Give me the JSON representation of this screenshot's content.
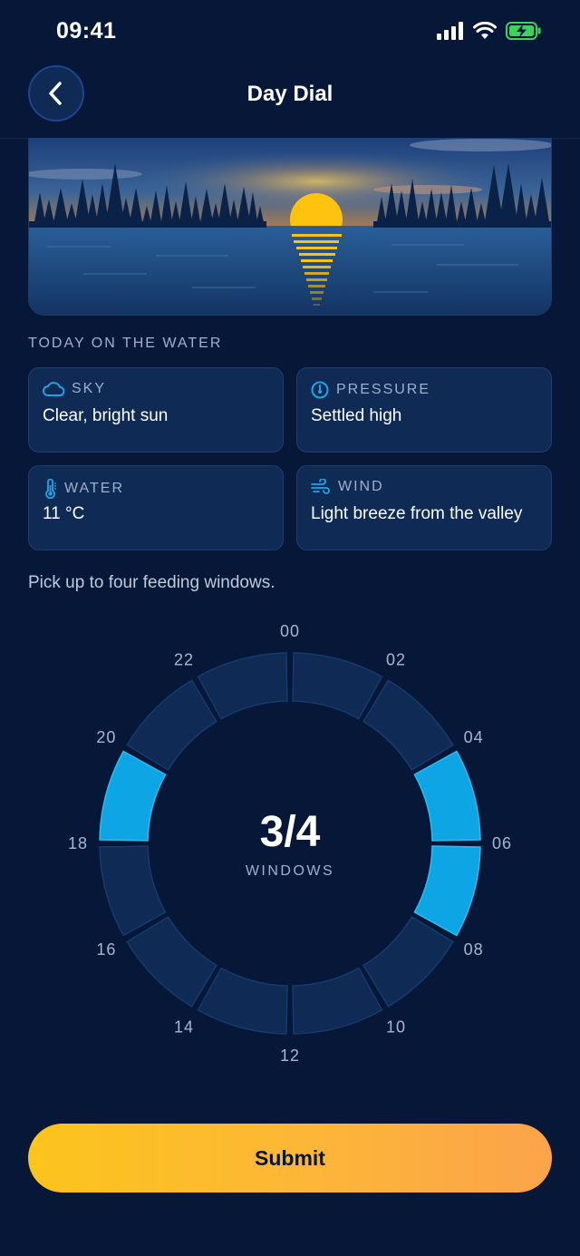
{
  "status": {
    "time": "09:41"
  },
  "nav": {
    "title": "Day Dial"
  },
  "section": {
    "label": "TODAY ON THE WATER"
  },
  "conditions": [
    {
      "label": "SKY",
      "value": "Clear, bright sun",
      "icon": "cloud-icon"
    },
    {
      "label": "PRESSURE",
      "value": "Settled high",
      "icon": "gauge-icon"
    },
    {
      "label": "WATER",
      "value": "11 °C",
      "icon": "thermometer-icon"
    },
    {
      "label": "WIND",
      "value": "Light breeze from the valley",
      "icon": "wind-icon"
    }
  ],
  "hint": "Pick up to four feeding windows.",
  "dial": {
    "hours": [
      "00",
      "02",
      "04",
      "06",
      "08",
      "10",
      "12",
      "14",
      "16",
      "18",
      "20",
      "22"
    ],
    "selected_hours": [
      "05",
      "07",
      "19"
    ],
    "selection_count": "3/4",
    "selection_label": "WINDOWS"
  },
  "submit_label": "Submit",
  "colors": {
    "background": "#071738",
    "card": "#0f2a55",
    "segment": "#0f2a55",
    "segment_selected": "#0ea5e4",
    "accent": "#fcc41c",
    "icon_blue": "#1ea7e8"
  }
}
